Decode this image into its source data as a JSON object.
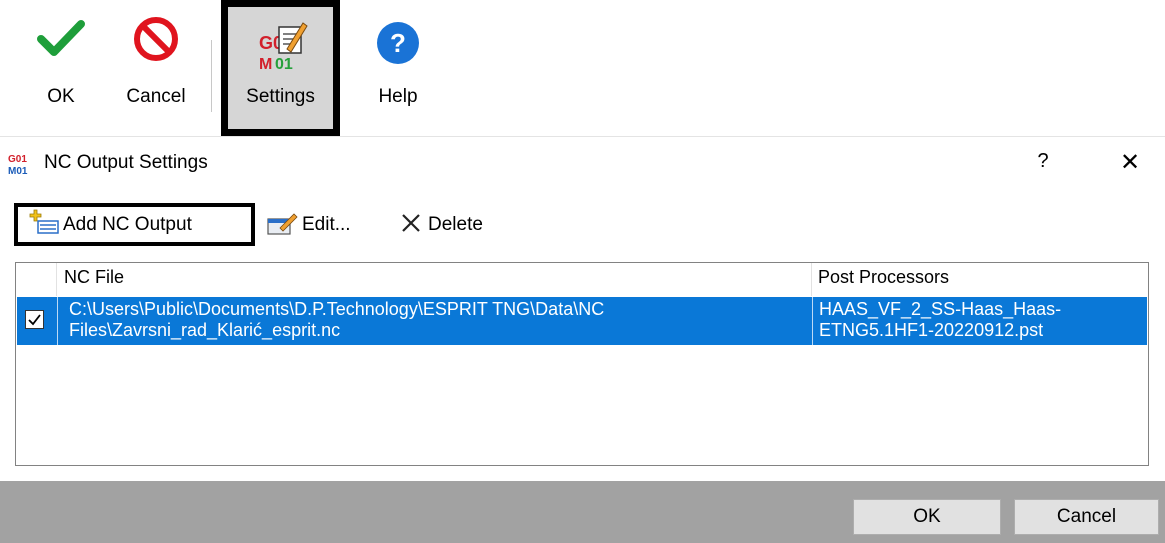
{
  "ribbon": {
    "ok_label": "OK",
    "cancel_label": "Cancel",
    "settings_label": "Settings",
    "help_label": "Help",
    "settings_icon_text_top": "G0",
    "settings_icon_text_bottom": "M01",
    "icons": {
      "ok": "check-icon",
      "cancel": "cancel-icon",
      "settings": "settings-icon",
      "help": "help-icon"
    }
  },
  "dialog": {
    "title": "NC Output Settings",
    "title_icon_top": "G01",
    "title_icon_bottom": "M01",
    "help_glyph": "?",
    "close_glyph": "✕"
  },
  "toolbar": {
    "add_label": "Add NC Output",
    "edit_label": "Edit...",
    "delete_label": "Delete"
  },
  "list": {
    "columns": [
      "NC File",
      "Post Processors"
    ],
    "rows": [
      {
        "checked": true,
        "nc_file": "C:\\Users\\Public\\Documents\\D.P.Technology\\ESPRIT TNG\\Data\\NC\nFiles\\Zavrsni_rad_Klarić_esprit.nc",
        "post_processor": "HAAS_VF_2_SS-Haas_Haas-\nETNG5.1HF1-20220912.pst"
      }
    ]
  },
  "footer": {
    "ok_label": "OK",
    "cancel_label": "Cancel"
  },
  "colors": {
    "selection": "#0a78d7",
    "ok_green": "#1e9e3a",
    "cancel_red": "#e0141e",
    "help_blue": "#1a73d6",
    "footer_bg": "#a2a2a2"
  }
}
